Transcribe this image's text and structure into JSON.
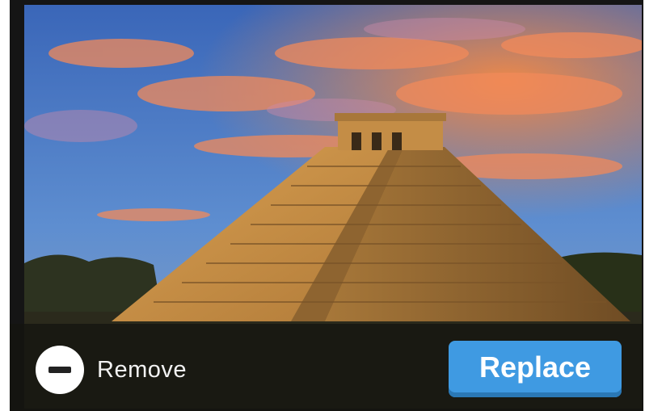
{
  "actions": {
    "remove_label": "Remove",
    "replace_label": "Replace"
  },
  "icons": {
    "remove": "minus-circle-icon"
  },
  "colors": {
    "replace_button": "#3f9ae2",
    "overlay": "#141410"
  }
}
